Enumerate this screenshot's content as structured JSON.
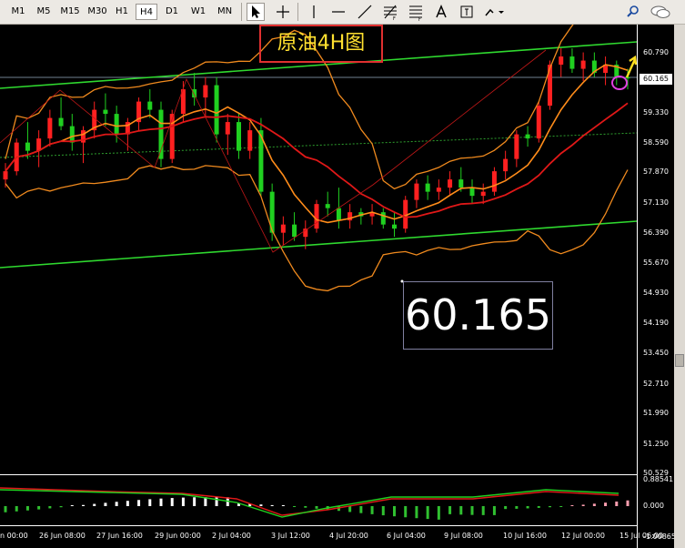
{
  "toolbar": {
    "timeframes": [
      "M1",
      "M5",
      "M15",
      "M30",
      "H1",
      "H4",
      "D1",
      "W1",
      "MN"
    ],
    "active_timeframe": "H4",
    "tools": [
      "cursor-icon",
      "crosshair-icon",
      "vertical-line-icon",
      "trend-line-icon",
      "fibonacci-icon",
      "period-separator-icon",
      "text-icon",
      "label-icon",
      "arrows-icon",
      "search-icon",
      "chat-icon"
    ]
  },
  "chart_title": "原油4H图",
  "current_price_display": "60.165",
  "price_axis": {
    "labels": [
      "60.790",
      "60.165",
      "59.330",
      "58.590",
      "57.870",
      "57.130",
      "56.390",
      "55.670",
      "54.930",
      "54.190",
      "53.450",
      "52.710",
      "51.990",
      "51.250",
      "50.529"
    ],
    "current_price": "60.165"
  },
  "indicator_axis": {
    "labels": [
      "0.88541",
      "0.000",
      "-1.00865"
    ]
  },
  "time_axis": {
    "labels": [
      "n 00:00",
      "26 Jun 08:00",
      "27 Jun 16:00",
      "29 Jun 00:00",
      "2 Jul 04:00",
      "3 Jul 12:00",
      "4 Jul 20:00",
      "6 Jul 04:00",
      "9 Jul 08:00",
      "10 Jul 16:00",
      "12 Jul 00:00",
      "15 Jul 06:00"
    ]
  },
  "chart_data": {
    "type": "candlestick",
    "symbol": "原油",
    "timeframe": "H4",
    "ylim": [
      50.529,
      61.4
    ],
    "y_ticks": [
      60.79,
      60.165,
      59.33,
      58.59,
      57.87,
      57.13,
      56.39,
      55.67,
      54.93,
      54.19,
      53.45,
      52.71,
      51.99,
      51.25,
      50.529
    ],
    "ohlc": [
      [
        57.7,
        58.1,
        57.5,
        57.9
      ],
      [
        57.9,
        58.7,
        57.8,
        58.6
      ],
      [
        58.6,
        59.1,
        58.2,
        58.4
      ],
      [
        58.4,
        58.9,
        58.0,
        58.7
      ],
      [
        58.7,
        59.4,
        58.5,
        59.2
      ],
      [
        59.2,
        59.7,
        58.9,
        59.0
      ],
      [
        59.0,
        59.3,
        58.4,
        58.6
      ],
      [
        58.6,
        59.0,
        58.1,
        58.9
      ],
      [
        58.9,
        59.6,
        58.7,
        59.4
      ],
      [
        59.4,
        59.8,
        59.0,
        59.3
      ],
      [
        59.3,
        59.5,
        58.6,
        58.8
      ],
      [
        58.8,
        59.2,
        58.4,
        59.1
      ],
      [
        59.1,
        59.7,
        58.9,
        59.6
      ],
      [
        59.6,
        59.9,
        59.2,
        59.4
      ],
      [
        59.4,
        59.6,
        58.0,
        58.2
      ],
      [
        58.2,
        59.4,
        58.1,
        59.3
      ],
      [
        59.3,
        60.1,
        59.1,
        59.9
      ],
      [
        59.9,
        60.3,
        59.5,
        59.7
      ],
      [
        59.7,
        60.2,
        59.2,
        60.0
      ],
      [
        60.0,
        60.2,
        58.6,
        58.8
      ],
      [
        58.8,
        59.3,
        58.3,
        59.1
      ],
      [
        59.1,
        59.3,
        58.2,
        58.4
      ],
      [
        58.4,
        59.1,
        58.2,
        58.9
      ],
      [
        58.9,
        59.2,
        57.3,
        57.4
      ],
      [
        57.4,
        57.6,
        56.2,
        56.4
      ],
      [
        56.4,
        56.8,
        56.1,
        56.6
      ],
      [
        56.6,
        56.9,
        56.2,
        56.3
      ],
      [
        56.3,
        56.7,
        56.0,
        56.5
      ],
      [
        56.5,
        57.2,
        56.4,
        57.1
      ],
      [
        57.1,
        57.4,
        56.8,
        57.0
      ],
      [
        57.0,
        57.5,
        56.5,
        56.7
      ],
      [
        56.7,
        57.1,
        56.5,
        56.9
      ],
      [
        56.9,
        57.0,
        56.6,
        56.8
      ],
      [
        56.8,
        57.1,
        56.6,
        56.9
      ],
      [
        56.9,
        57.0,
        56.5,
        56.6
      ],
      [
        56.6,
        56.9,
        56.3,
        56.5
      ],
      [
        56.5,
        57.3,
        56.4,
        57.2
      ],
      [
        57.2,
        57.7,
        57.0,
        57.6
      ],
      [
        57.6,
        57.8,
        57.2,
        57.4
      ],
      [
        57.4,
        57.7,
        57.2,
        57.5
      ],
      [
        57.5,
        57.9,
        57.3,
        57.7
      ],
      [
        57.7,
        58.0,
        57.4,
        57.5
      ],
      [
        57.5,
        57.7,
        57.1,
        57.3
      ],
      [
        57.3,
        57.6,
        57.1,
        57.4
      ],
      [
        57.4,
        58.0,
        57.3,
        57.9
      ],
      [
        57.9,
        58.4,
        57.7,
        58.2
      ],
      [
        58.2,
        58.9,
        58.0,
        58.8
      ],
      [
        58.8,
        59.0,
        58.5,
        58.7
      ],
      [
        58.7,
        59.6,
        58.6,
        59.5
      ],
      [
        59.5,
        60.6,
        59.4,
        60.5
      ],
      [
        60.5,
        60.9,
        60.2,
        60.7
      ],
      [
        60.7,
        60.9,
        60.3,
        60.4
      ],
      [
        60.4,
        60.8,
        60.1,
        60.6
      ],
      [
        60.6,
        60.8,
        60.2,
        60.3
      ],
      [
        60.3,
        60.7,
        60.0,
        60.5
      ],
      [
        60.5,
        60.6,
        60.0,
        60.2
      ],
      [
        60.2,
        60.4,
        59.9,
        60.165
      ]
    ],
    "overlays": [
      "bollinger-bands",
      "moving-average-fast",
      "moving-average-slow",
      "channel-lines"
    ],
    "indicator": {
      "type": "macd",
      "range": [
        -1.00865,
        0.88541
      ]
    }
  }
}
